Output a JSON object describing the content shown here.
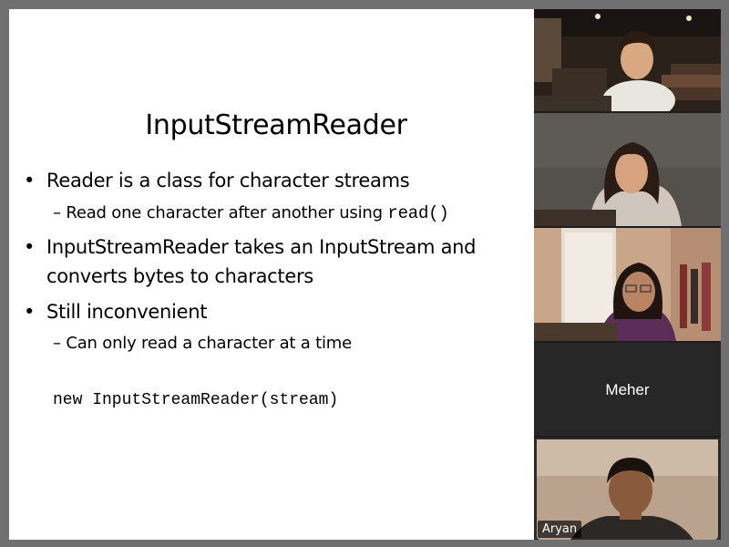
{
  "slide": {
    "title": "InputStreamReader",
    "bullets": [
      {
        "text": "Reader is a class for character streams",
        "sub": [
          {
            "prefix": "– Read one character after another using ",
            "code": "read()"
          }
        ]
      },
      {
        "text_line1": "InputStreamReader takes an InputStream and",
        "text_line2": "converts bytes to characters"
      },
      {
        "text": "Still inconvenient",
        "sub": [
          {
            "prefix": "– Can only read a character at a time"
          }
        ]
      }
    ],
    "bullet_glyph": "•",
    "code_line": "new InputStreamReader(stream)"
  },
  "gallery": {
    "participants": [
      {
        "kind": "video"
      },
      {
        "kind": "video"
      },
      {
        "kind": "video"
      },
      {
        "kind": "name_only",
        "name": "Meher"
      },
      {
        "kind": "video",
        "name": "Aryan"
      }
    ]
  },
  "colors": {
    "frame": "#707070",
    "gallery_bg": "#1d1d1d",
    "slide_bg": "#ffffff"
  }
}
